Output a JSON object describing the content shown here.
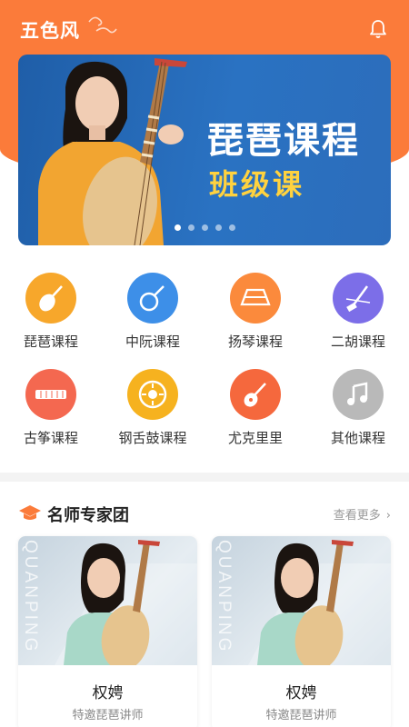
{
  "app": {
    "title": "五色风"
  },
  "banner": {
    "title": "琵琶课程",
    "subtitle": "班级课",
    "slides_total": 5,
    "active_slide": 1
  },
  "categories": [
    {
      "label": "琵琶课程",
      "icon": "pipa-icon",
      "color": "#f7a72b"
    },
    {
      "label": "中阮课程",
      "icon": "zhongruan-icon",
      "color": "#3d8fe8"
    },
    {
      "label": "扬琴课程",
      "icon": "yangqin-icon",
      "color": "#fb8a3c"
    },
    {
      "label": "二胡课程",
      "icon": "erhu-icon",
      "color": "#7c6ee8"
    },
    {
      "label": "古筝课程",
      "icon": "guzheng-icon",
      "color": "#f46850"
    },
    {
      "label": "钢舌鼓课程",
      "icon": "tongue-drum-icon",
      "color": "#f6b21f"
    },
    {
      "label": "尤克里里",
      "icon": "ukulele-icon",
      "color": "#f5683d"
    },
    {
      "label": "其他课程",
      "icon": "music-note-icon",
      "color": "#b9b9b9"
    }
  ],
  "experts": {
    "title": "名师专家团",
    "more_label": "查看更多",
    "cards": [
      {
        "name": "权娉",
        "role": "特邀琵琶讲师",
        "watermark": "QUANPING"
      },
      {
        "name": "权娉",
        "role": "特邀琵琶讲师",
        "watermark": "QUANPING"
      }
    ]
  },
  "colors": {
    "brand": "#fb7b3a",
    "banner_bg": "#2a72c2",
    "banner_subtitle": "#ffd23f"
  }
}
